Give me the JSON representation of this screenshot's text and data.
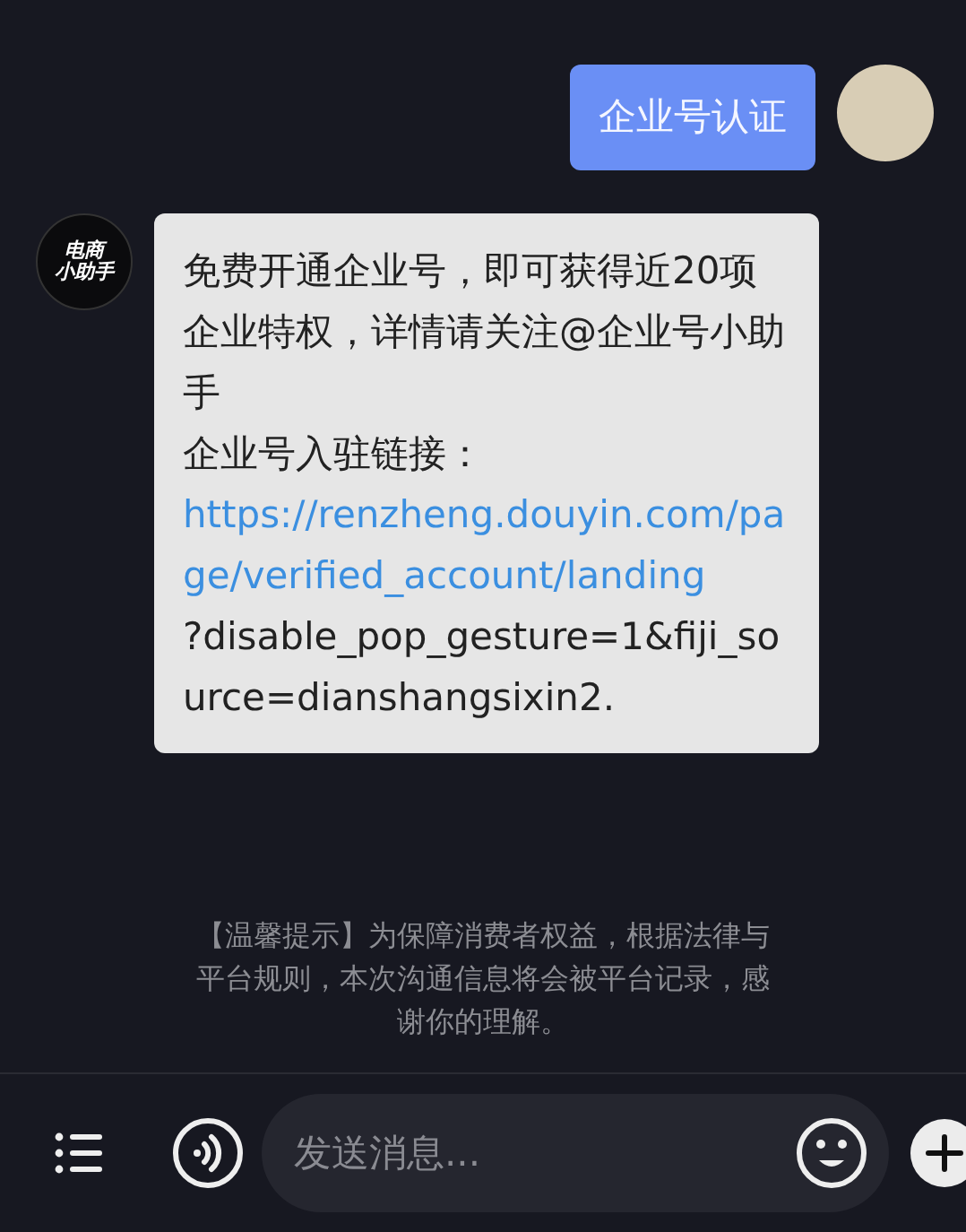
{
  "messages": [
    {
      "kind": "sent",
      "text": "企业号认证"
    },
    {
      "kind": "received",
      "avatar_text": [
        "电商",
        "小助手"
      ],
      "paragraphs": [
        "免费开通企业号，即可获得近20项企业特权，详情请关注@企业号小助手",
        "企业号入驻链接："
      ],
      "link": "https://renzheng.douyin.com/page/verified_account/landing",
      "after_link": "?disable_pop_gesture=1&fiji_source=dianshangsixin2."
    }
  ],
  "notice": "【温馨提示】为保障消费者权益，根据法律与平台规则，本次沟通信息将会被平台记录，感谢你的理解。",
  "input": {
    "placeholder": "发送消息..."
  }
}
